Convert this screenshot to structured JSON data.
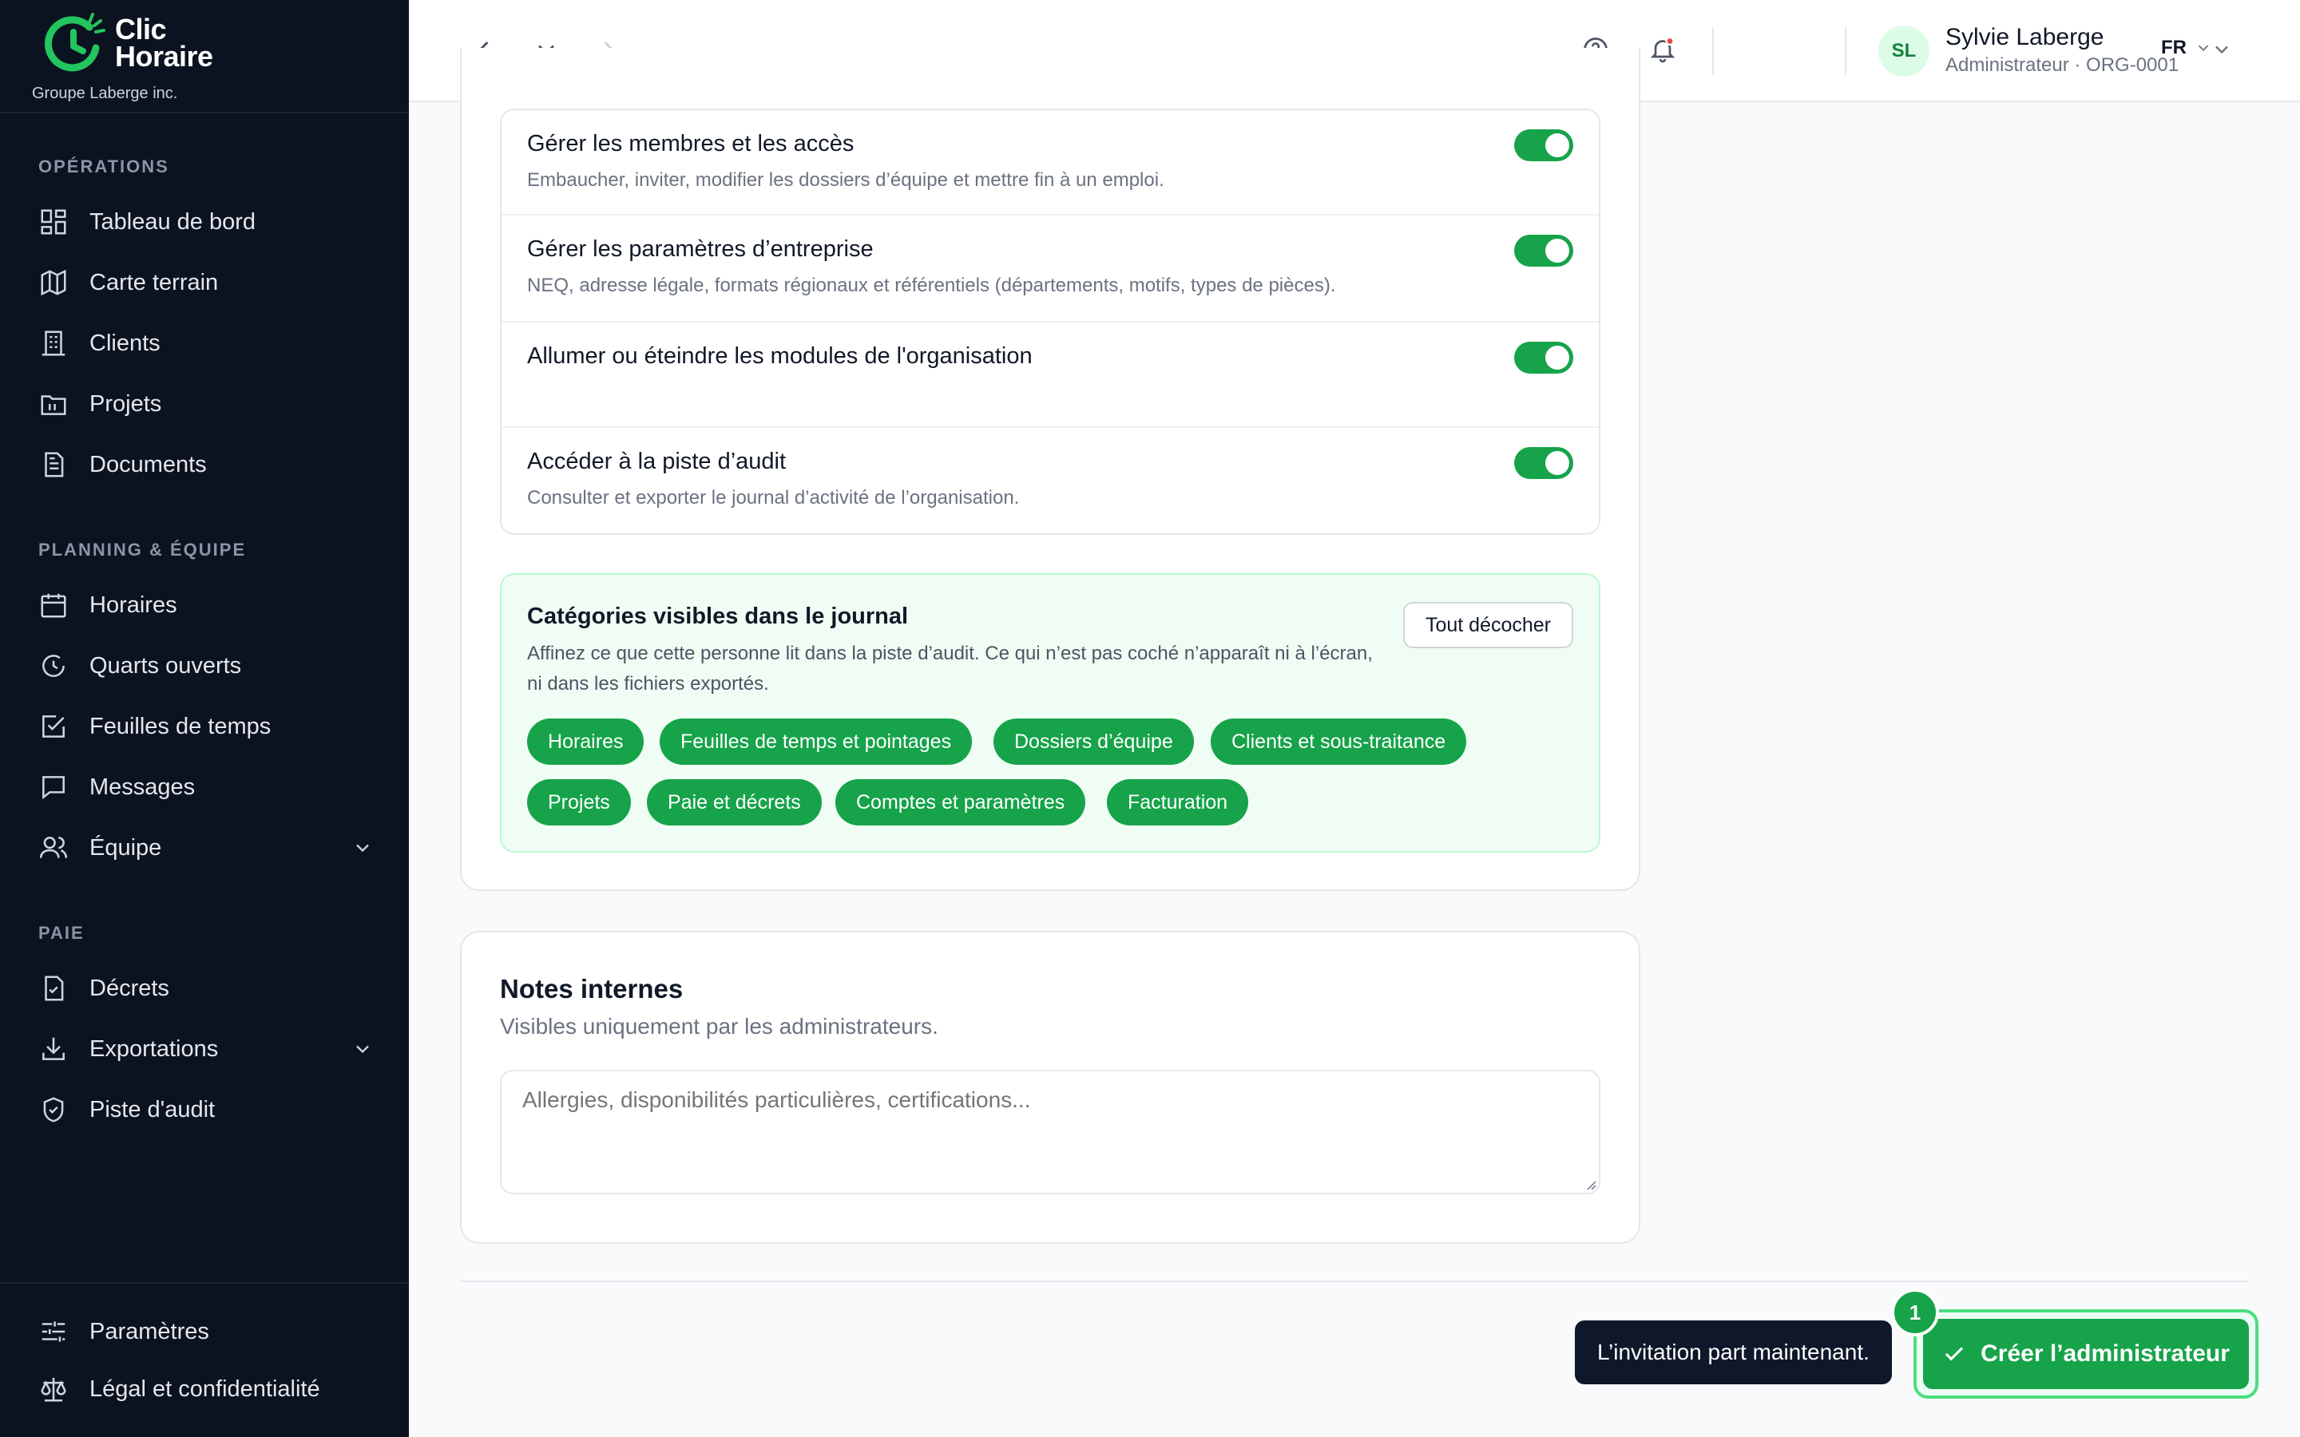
{
  "brand": {
    "name_line1": "Clic",
    "name_line2": "Horaire",
    "org": "Groupe Laberge inc.",
    "accent": "#16a34a"
  },
  "sidebar": {
    "sections": [
      {
        "title": "OPÉRATIONS",
        "items": [
          {
            "label": "Tableau de bord",
            "icon": "dashboard-icon"
          },
          {
            "label": "Carte terrain",
            "icon": "map-icon"
          },
          {
            "label": "Clients",
            "icon": "building-icon"
          },
          {
            "label": "Projets",
            "icon": "folder-icon"
          },
          {
            "label": "Documents",
            "icon": "document-icon"
          }
        ]
      },
      {
        "title": "PLANNING & ÉQUIPE",
        "items": [
          {
            "label": "Horaires",
            "icon": "calendar-icon"
          },
          {
            "label": "Quarts ouverts",
            "icon": "clock-icon"
          },
          {
            "label": "Feuilles de temps",
            "icon": "checklist-icon"
          },
          {
            "label": "Messages",
            "icon": "message-icon"
          },
          {
            "label": "Équipe",
            "icon": "users-icon"
          }
        ]
      },
      {
        "title": "PAIE",
        "items": [
          {
            "label": "Décrets",
            "icon": "decree-icon"
          },
          {
            "label": "Exportations",
            "icon": "download-icon"
          },
          {
            "label": "Piste d'audit",
            "icon": "shield-check-icon"
          }
        ]
      }
    ],
    "bottom": [
      {
        "label": "Paramètres",
        "icon": "sliders-icon"
      },
      {
        "label": "Légal et confidentialité",
        "icon": "scale-icon"
      }
    ]
  },
  "topbar": {
    "language": "FR",
    "user_initials": "SL",
    "user_name": "Sylvie Laberge",
    "user_role": "Administrateur · ORG-0001",
    "has_notification": true
  },
  "permissions": [
    {
      "title": "Gérer les membres et les accès",
      "desc": "Embaucher, inviter, modifier les dossiers d’équipe et mettre fin à un emploi.",
      "enabled": true
    },
    {
      "title": "Gérer les paramètres d’entreprise",
      "desc": "NEQ, adresse légale, formats régionaux et référentiels (départements, motifs, types de pièces).",
      "enabled": true
    },
    {
      "title": "Allumer ou éteindre les modules de l'organisation",
      "desc": "",
      "enabled": true
    },
    {
      "title": "Accéder à la piste d’audit",
      "desc": "Consulter et exporter le journal d’activité de l’organisation.",
      "enabled": true
    }
  ],
  "categories": {
    "title": "Catégories visibles dans le journal",
    "desc": "Affinez ce que cette personne lit dans la piste d’audit. Ce qui n’est pas coché n’apparaît ni à l’écran, ni dans les fichiers exportés.",
    "uncheck_label": "Tout décocher",
    "chips": [
      "Horaires",
      "Feuilles de temps et pointages",
      "Dossiers d’équipe",
      "Clients et sous-traitance",
      "Projets",
      "Paie et décrets",
      "Comptes et paramètres",
      "Facturation"
    ]
  },
  "notes": {
    "title": "Notes internes",
    "subtitle": "Visibles uniquement par les administrateurs.",
    "placeholder": "Allergies, disponibilités particulières, certifications..."
  },
  "footer": {
    "tooltip": "L’invitation part maintenant.",
    "create_label": "Créer l’administrateur",
    "step": "1"
  }
}
